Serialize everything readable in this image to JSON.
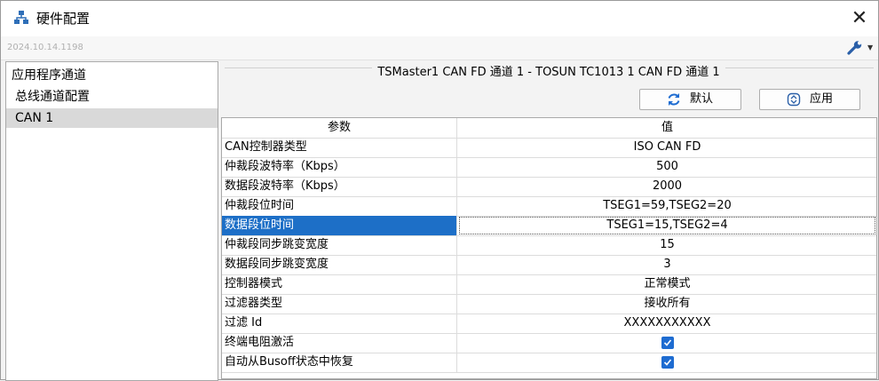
{
  "window": {
    "title": "硬件配置",
    "close_glyph": "✕"
  },
  "toolbar": {
    "version": "2024.10.14.1198",
    "tool_icon": "wrench-icon",
    "dropdown_glyph": "▼"
  },
  "tree": {
    "items": [
      {
        "label": "应用程序通道"
      },
      {
        "label": "总线通道配置"
      },
      {
        "label": "CAN 1",
        "selected": true
      }
    ]
  },
  "channel": {
    "title": "TSMaster1 CAN FD 通道 1 - TOSUN TC1013 1 CAN FD 通道 1",
    "default_label": "默认",
    "apply_label": "应用"
  },
  "grid": {
    "headers": [
      "参数",
      "值"
    ],
    "rows": [
      {
        "param": "CAN控制器类型",
        "value": "ISO CAN FD"
      },
      {
        "param": "仲裁段波特率（Kbps）",
        "value": "500"
      },
      {
        "param": "数据段波特率（Kbps）",
        "value": "2000"
      },
      {
        "param": "仲裁段位时间",
        "value": "TSEG1=59,TSEG2=20"
      },
      {
        "param": "数据段位时间",
        "value": "TSEG1=15,TSEG2=4",
        "selected": true
      },
      {
        "param": "仲裁段同步跳变宽度",
        "value": "15"
      },
      {
        "param": "数据段同步跳变宽度",
        "value": "3"
      },
      {
        "param": "控制器模式",
        "value": "正常模式"
      },
      {
        "param": "过滤器类型",
        "value": "接收所有"
      },
      {
        "param": "过滤 Id",
        "value": "XXXXXXXXXXX"
      },
      {
        "param": "终端电阻激活",
        "checked": true
      },
      {
        "param": "自动从Busoff状态中恢复",
        "checked": true
      }
    ]
  },
  "colors": {
    "selection": "#1d6fc7",
    "checkbox": "#1e6cd1",
    "tree_selection": "#d9d9d9"
  }
}
